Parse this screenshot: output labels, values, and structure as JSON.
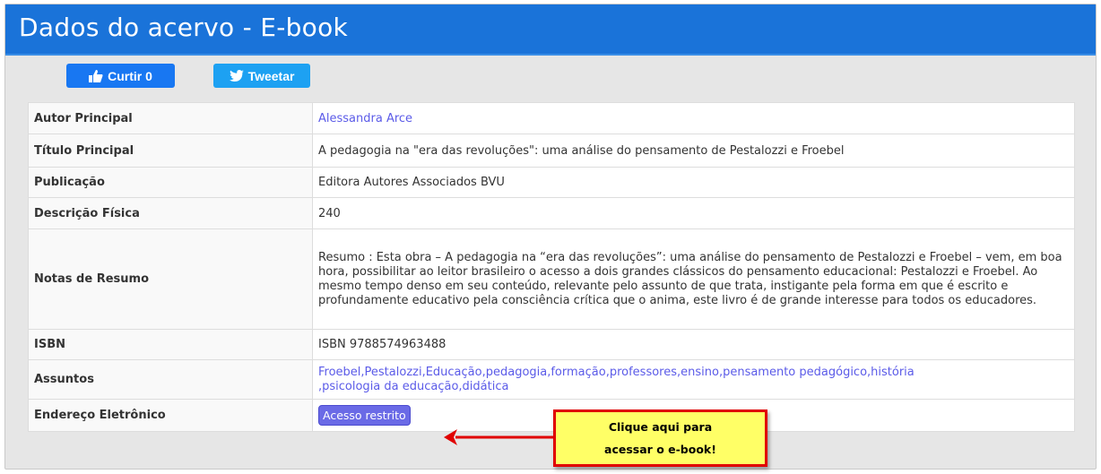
{
  "header": {
    "title": "Dados do acervo - E-book"
  },
  "social": {
    "like_label": "Curtir 0",
    "tweet_label": "Tweetar"
  },
  "record": {
    "author_label": "Autor Principal",
    "author_value": "Alessandra Arce",
    "title_label": "Título Principal",
    "title_value": "A pedagogia na \"era das revoluções\": uma análise do pensamento de Pestalozzi e Froebel",
    "publication_label": "Publicação",
    "publication_value": "Editora Autores Associados BVU",
    "physical_label": "Descrição Física",
    "physical_value": "240",
    "summary_label": "Notas de Resumo",
    "summary_value": "Resumo : Esta obra – A pedagogia na “era das revoluções”: uma análise do pensamento de Pestalozzi e Froebel – vem, em boa hora, possibilitar ao leitor brasileiro o acesso a dois grandes clássicos do pensamento educacional: Pestalozzi e Froebel. Ao mesmo tempo denso em seu conteúdo, relevante pelo assunto de que trata, instigante pela forma em que é escrito e profundamente educativo pela consciência crítica que o anima, este livro é de grande interesse para todos os educadores.",
    "isbn_label": "ISBN",
    "isbn_value": "ISBN 9788574963488",
    "subjects_label": "Assuntos",
    "subjects_line1": "Froebel,Pestalozzi,Educação,pedagogia,formação,professores,ensino,pensamento pedagógico,história",
    "subjects_line2": ",psicologia da educação,didática",
    "url_label": "Endereço Eletrônico",
    "url_button": "Acesso restrito"
  },
  "callout": {
    "line1": "Clique aqui para",
    "line2": "acessar o e-book!"
  },
  "colors": {
    "title_bar": "#1a73d9",
    "link": "#5b5be8",
    "callout_bg": "#ffff66",
    "callout_border": "#e00000"
  },
  "icons": {
    "like": "thumbs-up-icon",
    "tweet": "twitter-bird-icon",
    "arrow": "arrow-left-icon"
  }
}
